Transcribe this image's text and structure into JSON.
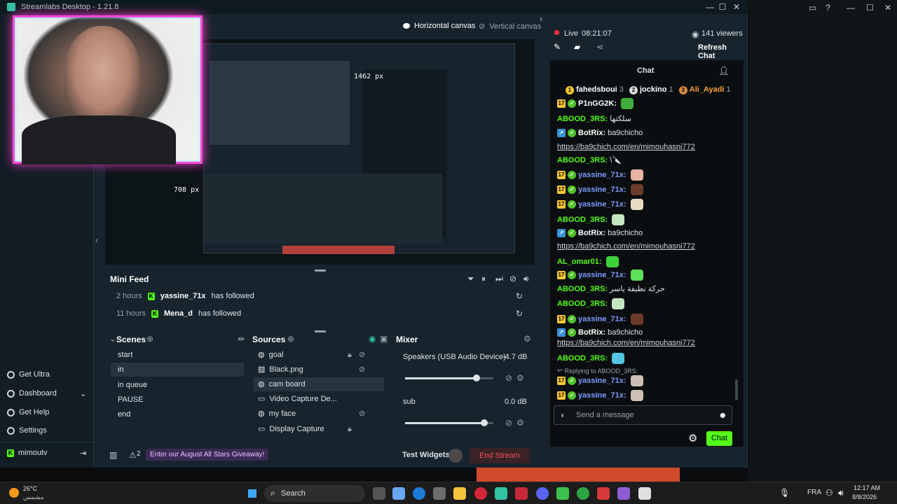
{
  "app": {
    "title": "Streamlabs Desktop - 1.21.8"
  },
  "canvas": {
    "horizontal": "Horizontal canvas",
    "vertical": "Vertical canvas"
  },
  "preview": {
    "dim_px_top": "1462 px",
    "dim_px_left": "708 px"
  },
  "live": {
    "status": "Live",
    "time": "08:21:07",
    "viewers": "141 viewers",
    "refresh": "Refresh Chat"
  },
  "chat": {
    "title": "Chat",
    "top": [
      {
        "rank": "1",
        "name": "fahedsboui",
        "count": "3"
      },
      {
        "rank": "2",
        "name": "jockino",
        "count": "1"
      },
      {
        "rank": "3",
        "name": "Ali_Ayadi",
        "count": "1"
      }
    ],
    "messages": [
      {
        "name": "P1nGG2K:",
        "color": "#ffffff",
        "text": "",
        "badges": "sub-ver",
        "emote": "#3fae3b"
      },
      {
        "name": "ABOOD_3RS:",
        "color": "#53fc18",
        "text": "سلكتها",
        "badges": "",
        "emote": ""
      },
      {
        "name": "BotRix:",
        "color": "#ffffff",
        "text": "ba9chicho",
        "badges": "bot-ver",
        "emote": ""
      },
      {
        "name": "",
        "color": "",
        "text": "https://ba9chich.com/en/mimouhasni772",
        "badges": "link",
        "emote": ""
      },
      {
        "name": "ABOOD_3RS:",
        "color": "#53fc18",
        "text": "\\🔪",
        "badges": "",
        "emote": ""
      },
      {
        "name": "yassine_71x:",
        "color": "#7d9cff",
        "text": "",
        "badges": "sub-ver",
        "emote": "#e8b4a4"
      },
      {
        "name": "yassine_71x:",
        "color": "#7d9cff",
        "text": "",
        "badges": "sub-ver",
        "emote": "#6b3b2a"
      },
      {
        "name": "yassine_71x:",
        "color": "#7d9cff",
        "text": "",
        "badges": "sub-ver",
        "emote": "#e9dcc4"
      },
      {
        "name": "ABOOD_3RS:",
        "color": "#53fc18",
        "text": "",
        "badges": "",
        "emote": "#c4e6c0"
      },
      {
        "name": "BotRix:",
        "color": "#ffffff",
        "text": "ba9chicho",
        "badges": "bot-ver",
        "emote": ""
      },
      {
        "name": "",
        "color": "",
        "text": "https://ba9chich.com/en/mimouhasni772",
        "badges": "link",
        "emote": ""
      },
      {
        "name": "AL_omar01:",
        "color": "#53fc18",
        "text": "",
        "badges": "",
        "emote": "#3fd13b"
      },
      {
        "name": "yassine_71x:",
        "color": "#7d9cff",
        "text": "",
        "badges": "sub-ver",
        "emote": "#5ee05a"
      },
      {
        "name": "ABOOD_3RS:",
        "color": "#53fc18",
        "text": "حركة نظيفة ياسر",
        "badges": "",
        "emote": ""
      },
      {
        "name": "ABOOD_3RS:",
        "color": "#53fc18",
        "text": "",
        "badges": "",
        "emote": "#c4e6c0"
      },
      {
        "name": "yassine_71x:",
        "color": "#7d9cff",
        "text": "",
        "badges": "sub-ver",
        "emote": "#6b3b2a"
      },
      {
        "name": "BotRix:",
        "color": "#ffffff",
        "text": "ba9chicho",
        "badges": "bot-ver",
        "emote": ""
      },
      {
        "name": "",
        "color": "",
        "text": "https://ba9chich.com/en/mimouhasni772",
        "badges": "link",
        "emote": ""
      },
      {
        "name": "ABOOD_3RS:",
        "color": "#53fc18",
        "text": "",
        "badges": "",
        "emote": "#55c4e0"
      },
      {
        "name": "",
        "color": "",
        "text": "Replying to ABOOD_3RS:",
        "badges": "reply",
        "emote": ""
      },
      {
        "name": "yassine_71x:",
        "color": "#7d9cff",
        "text": "",
        "badges": "sub-ver",
        "emote": "#cdbfb3"
      },
      {
        "name": "yassine_71x:",
        "color": "#7d9cff",
        "text": "",
        "badges": "sub-ver",
        "emote": "#cdbfb3"
      }
    ],
    "input_placeholder": "Send a message",
    "send": "Chat"
  },
  "minifeed": {
    "title": "Mini Feed",
    "rows": [
      {
        "time": "2 hours",
        "user": "yassine_71x",
        "action": "has followed"
      },
      {
        "time": "11 hours",
        "user": "Mena_d",
        "action": "has followed"
      }
    ]
  },
  "scenes": {
    "title": "Scenes",
    "items": [
      "start",
      "in",
      "in queue",
      "PAUSE",
      "end"
    ]
  },
  "sources": {
    "title": "Sources",
    "items": [
      "goal",
      "Black.png",
      "cam board",
      "Video Capture De...",
      "my face",
      "Display Capture"
    ]
  },
  "mixer": {
    "title": "Mixer",
    "channels": [
      {
        "name": "Speakers (USB Audio Device)",
        "db": "-4.7 dB",
        "level": 0.81
      },
      {
        "name": "sub",
        "db": "0.0 dB",
        "level": 0.9
      }
    ]
  },
  "nav": {
    "items": [
      "Get Ultra",
      "Dashboard",
      "Get Help",
      "Settings"
    ],
    "user": "mimoutv"
  },
  "footer": {
    "giveaway": "Enter our August All Stars Giveaway!",
    "alerts": "2",
    "test_widgets": "Test Widgets",
    "end_stream": "End Stream"
  },
  "taskbar": {
    "temp": "26°C",
    "weather": "مشمس",
    "search": "Search",
    "lang": "FRA",
    "time": "12:17 AM",
    "date": "8/8/2026"
  }
}
